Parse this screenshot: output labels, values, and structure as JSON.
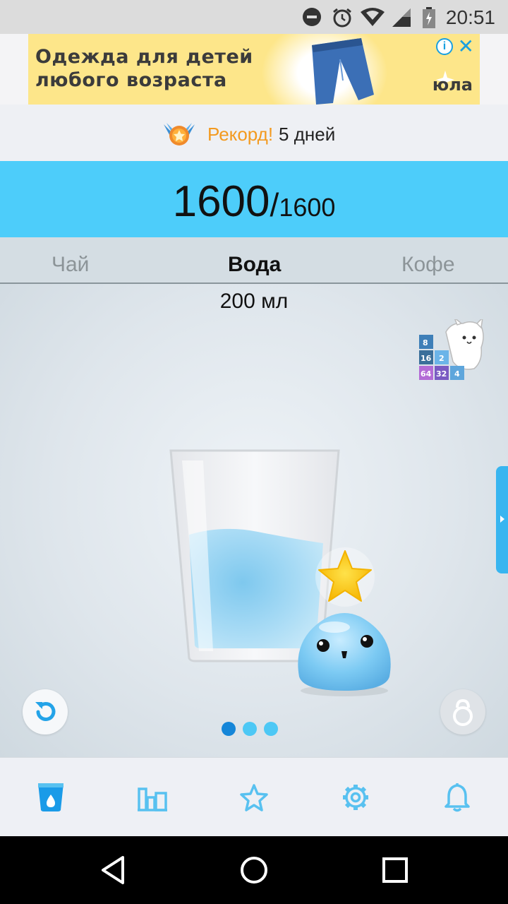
{
  "status_bar": {
    "time": "20:51",
    "icons": [
      "do-not-disturb-icon",
      "alarm-icon",
      "wifi-icon",
      "signal-icon",
      "battery-icon"
    ]
  },
  "ad": {
    "text": "Одежда для детей любого возраста",
    "brand": "юла",
    "info_label": "i",
    "close_label": "✕"
  },
  "record": {
    "label": "Рекорд!",
    "days": "5 дней",
    "icon": "medal-icon"
  },
  "counter": {
    "current": "1600",
    "separator": "/",
    "goal": "1600"
  },
  "tabs": [
    {
      "label": "Чай",
      "active": false
    },
    {
      "label": "Вода",
      "active": true
    },
    {
      "label": "Кофе",
      "active": false
    }
  ],
  "drink": {
    "amount": "200 мл",
    "fill_fraction": 0.62
  },
  "game_promo": {
    "tiles": [
      "8",
      "16",
      "2",
      "64",
      "32",
      "4"
    ]
  },
  "pager": {
    "count": 3,
    "active_index": 0
  },
  "bottom_nav": [
    {
      "icon": "water-cup-icon",
      "active": true
    },
    {
      "icon": "statistics-icon",
      "active": false
    },
    {
      "icon": "star-icon",
      "active": false
    },
    {
      "icon": "settings-gear-icon",
      "active": false
    },
    {
      "icon": "bell-icon",
      "active": false
    }
  ],
  "colors": {
    "accent": "#4dcdfa",
    "record_orange": "#f39a1f",
    "nav_active": "#1a9be8",
    "nav_inactive": "#58c1f0",
    "dot_active": "#1586d8"
  }
}
